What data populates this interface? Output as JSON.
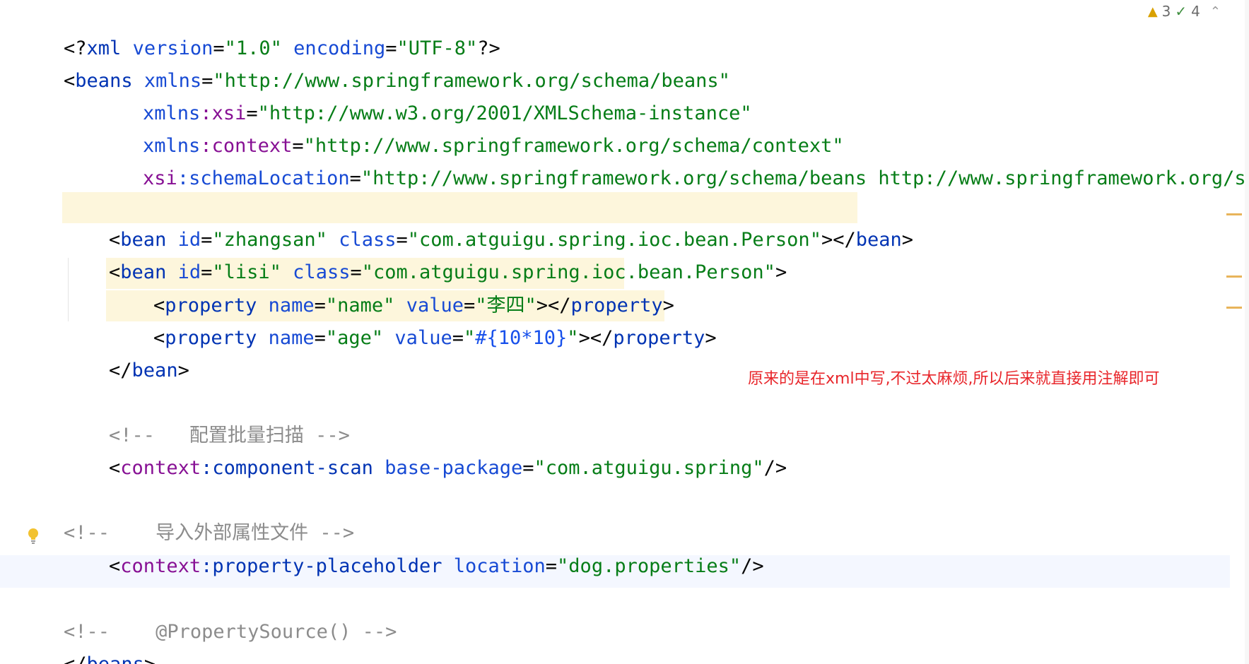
{
  "status": {
    "warnings": "3",
    "checks": "4",
    "warning_icon": "warning-icon",
    "check_icon": "check-icon",
    "chevron_icon": "chevron-up-icon"
  },
  "annotation": "原来的是在xml中写,不过太麻烦,所以后来就直接用注解即可",
  "code": {
    "l1": {
      "a": "<?",
      "b": "xml",
      "c": " version",
      "d": "=",
      "e": "\"1.0\"",
      "f": " encoding",
      "g": "=",
      "h": "\"UTF-8\"",
      "i": "?>"
    },
    "l2": {
      "a": "<",
      "b": "beans",
      "c": " xmlns",
      "d": "=",
      "e": "\"http://www.springframework.org/schema/beans\""
    },
    "l3": {
      "a": "xmlns",
      "b": ":xsi",
      "c": "=",
      "d": "\"http://www.w3.org/2001/XMLSchema-instance\""
    },
    "l4": {
      "a": "xmlns",
      "b": ":context",
      "c": "=",
      "d": "\"http://www.springframework.org/schema/context\""
    },
    "l5": {
      "a": "xsi",
      "b": ":schemaLocation",
      "c": "=",
      "d": "\"http://www.springframework.org/schema/beans http://www.springframework.org/schema"
    },
    "l6": {
      "a": "<",
      "b": "bean",
      "c": " id",
      "d": "=",
      "e": "\"zhangsan\"",
      "f": " class",
      "g": "=",
      "h": "\"com.atguigu.spring.ioc.bean.Person\"",
      "i": "></",
      "j": "bean",
      "k": ">"
    },
    "l7": {
      "a": "<",
      "b": "bean",
      "c": " id",
      "d": "=",
      "e": "\"lisi\"",
      "f": " class",
      "g": "=",
      "h": "\"com.atguigu.spring.ioc.bean.Person\"",
      "i": ">"
    },
    "l8": {
      "a": "<",
      "b": "property",
      "c": " name",
      "d": "=",
      "e": "\"name\"",
      "f": " value",
      "g": "=",
      "h": "\"李四\"",
      "i": "></",
      "j": "property",
      "k": ">"
    },
    "l9": {
      "a": "<",
      "b": "property",
      "c": " name",
      "d": "=",
      "e": "\"age\"",
      "f": " value",
      "g": "=",
      "h": "\"",
      "i": "#{10*10}",
      "j": "\"",
      "k": "></",
      "l": "property",
      "m": ">"
    },
    "l10": {
      "a": "</",
      "b": "bean",
      "c": ">"
    },
    "l11": {
      "a": "<!--   配置批量扫描 -->"
    },
    "l12": {
      "a": "<",
      "b": "context",
      "c": ":component-scan",
      "d": " base-package",
      "e": "=",
      "f": "\"com.atguigu.spring\"",
      "g": "/>"
    },
    "l13": {
      "a": "<!--    导入外部属性文件 -->"
    },
    "l14": {
      "a": "<",
      "b": "context",
      "c": ":property-placeholder",
      "d": " location",
      "e": "=",
      "f": "\"dog.properties\"",
      "g": "/>"
    },
    "l15": {
      "a": "<!--    @PropertySource() -->"
    },
    "l16": {
      "a": "</",
      "b": "beans",
      "c": ">"
    }
  },
  "colors": {
    "tag": "#0033b3",
    "attribute": "#174ad4",
    "value": "#067d17",
    "comment": "#8c8c8c",
    "annotation": "#e8262b"
  }
}
